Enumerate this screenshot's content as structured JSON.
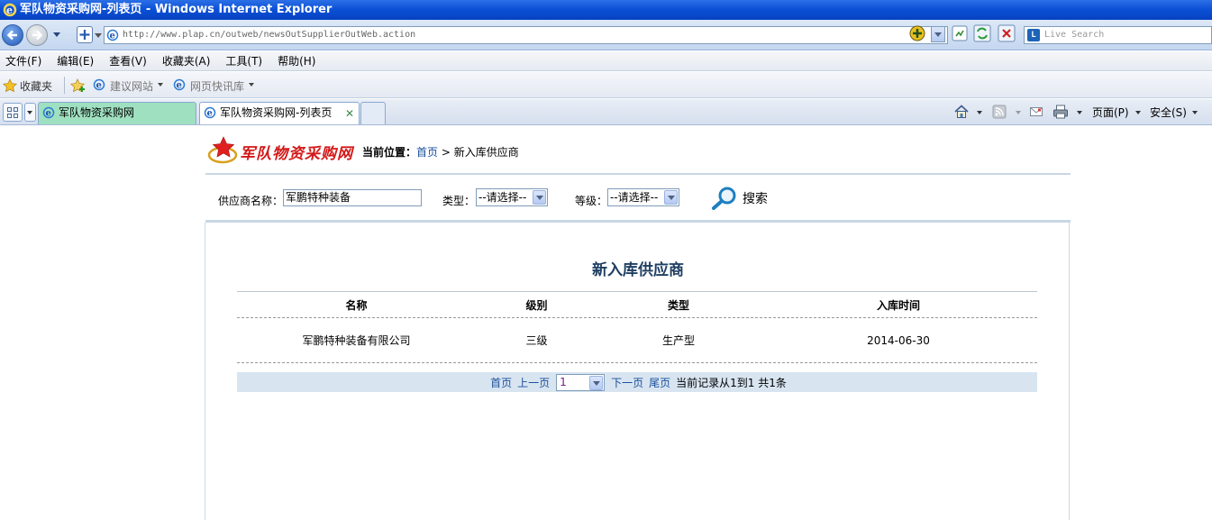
{
  "window": {
    "title": "军队物资采购网-列表页 - Windows Internet Explorer"
  },
  "nav": {
    "address": "http://www.plap.cn/outweb/newsOutSupplierOutWeb.action",
    "search_placeholder": "Live Search"
  },
  "menu": {
    "items": [
      "文件(F)",
      "编辑(E)",
      "查看(V)",
      "收藏夹(A)",
      "工具(T)",
      "帮助(H)"
    ]
  },
  "favorites": {
    "label": "收藏夹",
    "suggested": "建议网站",
    "webslice": "网页快讯库"
  },
  "tabs": [
    {
      "label": "军队物资采购网"
    },
    {
      "label": "军队物资采购网-列表页"
    }
  ],
  "commands": {
    "page": "页面(P)",
    "safety": "安全(S)"
  },
  "site": {
    "logo_text": "军队物资采购网",
    "breadcrumb_label": "当前位置：",
    "breadcrumb_home": "首页",
    "breadcrumb_sep": ">",
    "breadcrumb_current": "新入库供应商"
  },
  "filter": {
    "name_label": "供应商名称：",
    "name_value": "军鹏特种装备",
    "type_label": "类型：",
    "type_value": "--请选择--",
    "level_label": "等级：",
    "level_value": "--请选择--",
    "search_label": "搜索"
  },
  "list": {
    "title": "新入库供应商",
    "headers": [
      "名称",
      "级别",
      "类型",
      "入库时间"
    ],
    "rows": [
      [
        "军鹏特种装备有限公司",
        "三级",
        "生产型",
        "2014-06-30"
      ]
    ]
  },
  "pager": {
    "first": "首页",
    "prev": "上一页",
    "page_value": "1",
    "next": "下一页",
    "last": "尾页",
    "info": "当前记录从1到1 共1条"
  },
  "colors": {
    "titlebar": "#0a4fd6",
    "link": "#1a4f9b",
    "list_title": "#1f3f62",
    "pager_bg": "#d8e5f1",
    "active_tab": "#9fe0c0"
  }
}
